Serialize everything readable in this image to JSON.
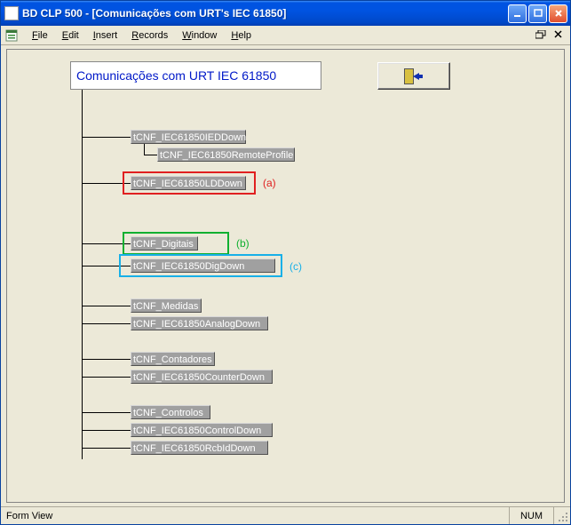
{
  "titlebar": {
    "text": "BD CLP 500 - [Comunicações com URT's IEC 61850]"
  },
  "menubar": {
    "file": "File",
    "edit": "Edit",
    "insert": "Insert",
    "records": "Records",
    "window": "Window",
    "help": "Help"
  },
  "root_label": "Comunicações com URT IEC 61850",
  "nodes": {
    "ied_down": "tCNF_IEC61850IEDDown",
    "remote_profile": "tCNF_IEC61850RemoteProfile",
    "ld_down": "tCNF_IEC61850LDDown",
    "digitais": "tCNF_Digitais",
    "dig_down": "tCNF_IEC61850DigDown",
    "medidas": "tCNF_Medidas",
    "analog_down": "tCNF_IEC61850AnalogDown",
    "contadores": "tCNF_Contadores",
    "counter_down": "tCNF_IEC61850CounterDown",
    "controlos": "tCNF_Controlos",
    "control_down": "tCNF_IEC61850ControlDown",
    "rcbid_down": "tCNF_IEC61850RcbIdDown"
  },
  "tags": {
    "a": "(a)",
    "b": "(b)",
    "c": "(c)"
  },
  "statusbar": {
    "left": "Form View",
    "num": "NUM"
  }
}
